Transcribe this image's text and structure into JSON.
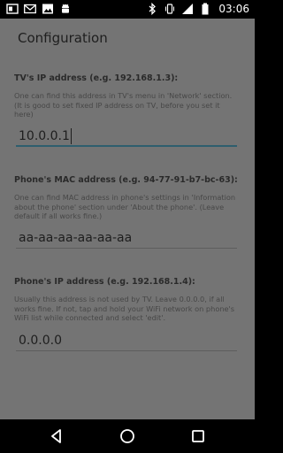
{
  "status_bar": {
    "time": "03:06",
    "left_icons": [
      "notification-icon",
      "gmail-icon",
      "gallery-icon",
      "android-icon"
    ],
    "right_icons": [
      "bluetooth-icon",
      "vibrate-icon",
      "signal-icon",
      "battery-icon"
    ]
  },
  "dialog": {
    "title": "Configuration"
  },
  "sections": [
    {
      "heading": "TV's IP address (e.g. 192.168.1.3):",
      "description": "One can find this address in TV's menu in 'Network' section. (It is good to set fixed IP address on TV, before you set it here)",
      "value": "10.0.0.1",
      "focused": true
    },
    {
      "heading": "Phone's MAC address (e.g. 94-77-91-b7-bc-63):",
      "description": "One can find MAC address in phone's settings in 'Information about the phone' section under 'About the phone'. (Leave default if all works fine.)",
      "value": "aa-aa-aa-aa-aa-aa",
      "focused": false
    },
    {
      "heading": "Phone's IP address (e.g. 192.168.1.4):",
      "description": "Usually this address is not used by TV. Leave 0.0.0.0, if all works fine. If not, tap and hold your WiFi network on phone's WiFi list while connected and select 'edit'.",
      "value": "0.0.0.0",
      "focused": false
    }
  ],
  "nav_bar": {
    "buttons": [
      "back-icon",
      "home-icon",
      "recents-icon"
    ]
  },
  "colors": {
    "dialog_background": "#747474",
    "focus_underline": "#2e5e6e"
  }
}
